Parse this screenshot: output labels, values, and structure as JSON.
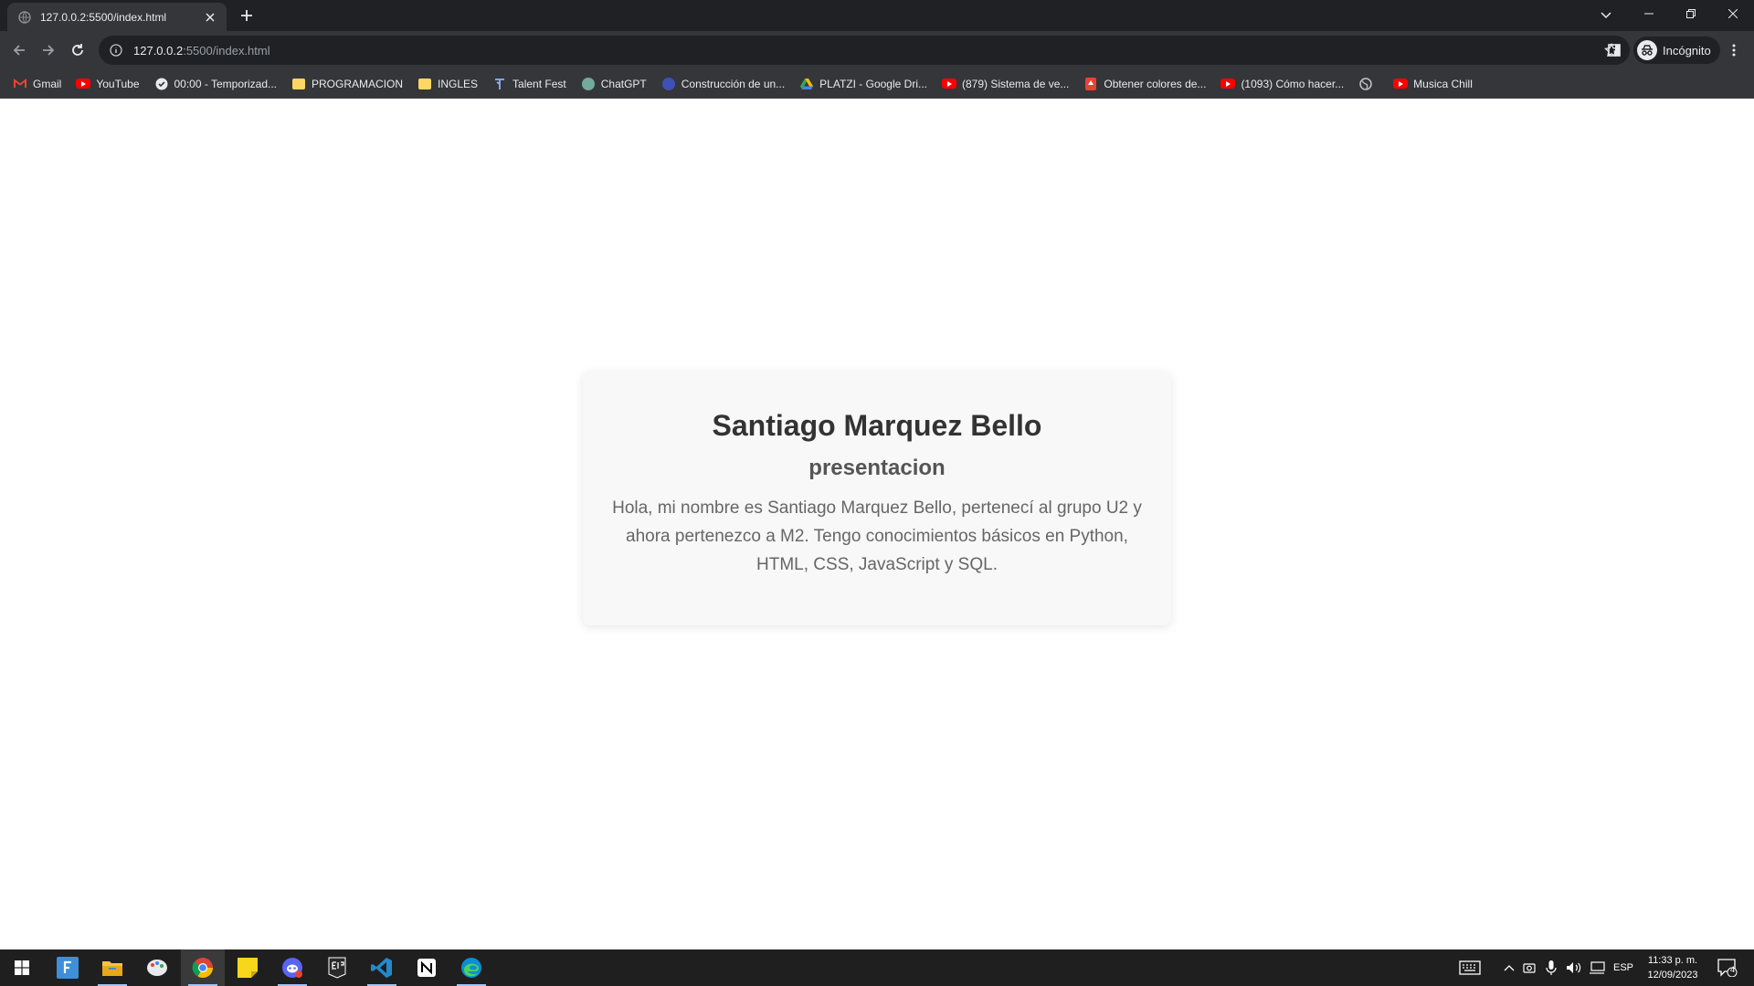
{
  "browser": {
    "tab": {
      "title": "127.0.0.2:5500/index.html"
    },
    "address": {
      "host": "127.0.0.2",
      "path": ":5500/index.html"
    },
    "profile_label": "Incógnito"
  },
  "bookmarks": [
    {
      "label": "Gmail",
      "icon": "gmail-icon"
    },
    {
      "label": "YouTube",
      "icon": "youtube-icon"
    },
    {
      "label": "00:00 - Temporizad...",
      "icon": "timer-icon"
    },
    {
      "label": "PROGRAMACION",
      "icon": "folder-icon"
    },
    {
      "label": "INGLES",
      "icon": "folder-icon"
    },
    {
      "label": "Talent Fest",
      "icon": "talent-fest-icon"
    },
    {
      "label": "ChatGPT",
      "icon": "chatgpt-icon"
    },
    {
      "label": "Construcción de un...",
      "icon": "globe-icon"
    },
    {
      "label": "PLATZI - Google Dri...",
      "icon": "google-drive-icon"
    },
    {
      "label": "(879) Sistema de ve...",
      "icon": "youtube-icon"
    },
    {
      "label": "Obtener colores de...",
      "icon": "color-picker-icon"
    },
    {
      "label": "(1093) Cómo hacer...",
      "icon": "youtube-icon"
    },
    {
      "label": "",
      "icon": "globe-icon"
    },
    {
      "label": "Musica Chill",
      "icon": "youtube-icon"
    }
  ],
  "card": {
    "name": "Santiago Marquez Bello",
    "subtitle": "presentacion",
    "body": "Hola, mi nombre es Santiago Marquez Bello, pertenecí al grupo U2 y ahora pertenezco a M2. Tengo conocimientos básicos en Python, HTML, CSS, JavaScript y SQL."
  },
  "taskbar": {
    "language": "ESP",
    "time": "11:33 p. m.",
    "date": "12/09/2023",
    "notification_count": "4"
  },
  "colors": {
    "tab_strip": "#202124",
    "toolbar": "#35363a",
    "card_background": "#f8f8f8",
    "title_text": "#333333",
    "subtitle_text": "#555555",
    "body_text": "#666666",
    "taskbar": "#1f1f1f"
  }
}
